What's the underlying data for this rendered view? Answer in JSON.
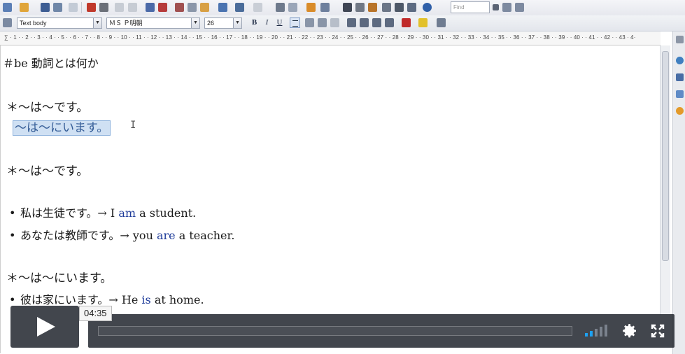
{
  "toolbar": {
    "find_placeholder": "Find"
  },
  "format_bar": {
    "paragraph_style": "Text body",
    "font_name": "ＭＳ Ｐ明朝",
    "font_size": "26",
    "bold_label": "B",
    "italic_label": "I",
    "underline_label": "U"
  },
  "ruler": {
    "marks": "∑ · 1 · · 2 · · 3 · · 4 · · 5 · · 6 · · 7 · · 8 · · 9 · · 10 · · 11 · · 12 · · 13 · · 14 · · 15 · · 16 · · 17 · · 18 · · 19 · · 20 · · 21 · · 22 · · 23 · · 24 · · 25 · · 26 · · 27 · · 28 · · 29 · · 30 · · 31 · · 32 · · 33 · · 34 · · 35 · · 36 · · 37 · · 38 · · 39 · · 40 · · 41 · · 42 · · 43 · 4·"
  },
  "document": {
    "title": "＃be 動詞とは何か",
    "section1_heading": "＊～は～です。",
    "section1_selected": "～は～にいます。",
    "section2_heading": "＊～は～です。",
    "bullet1_jp": "私は生徒です。→ I ",
    "bullet1_verb": "am",
    "bullet1_rest": " a student.",
    "bullet2_jp": "あなたは教師です。→ you ",
    "bullet2_verb": "are",
    "bullet2_rest": " a teacher.",
    "section3_heading": "＊～は～にいます。",
    "bullet3_jp": "彼は家にいます。→ He ",
    "bullet3_verb": "is",
    "bullet3_rest": " at home.",
    "bullet_symbol": "•"
  },
  "player": {
    "timecode": "04:35",
    "progress_fraction": 0.0
  },
  "colors": {
    "verb_highlight": "#1f3c9a",
    "selection_bg": "#cfe0f3",
    "player_bg": "#282c34"
  }
}
